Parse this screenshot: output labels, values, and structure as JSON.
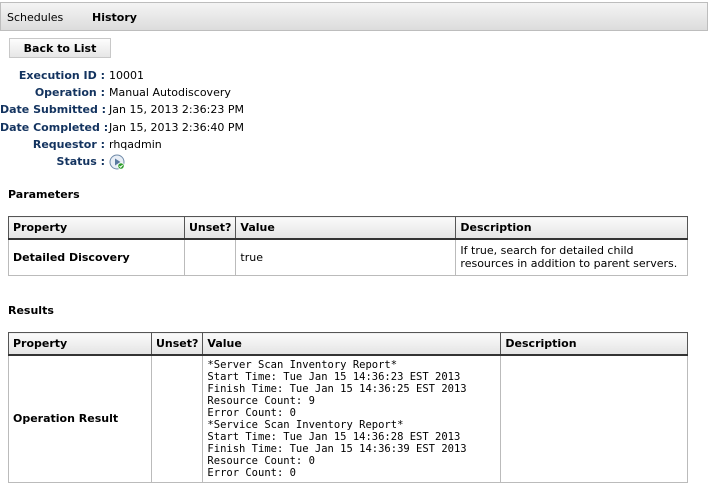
{
  "tabs": [
    "Schedules",
    "History"
  ],
  "back_label": "Back to List",
  "details": [
    {
      "label": "Execution ID :",
      "value": "10001"
    },
    {
      "label": "Operation :",
      "value": "Manual Autodiscovery"
    },
    {
      "label": "Date Submitted :",
      "value": "Jan 15, 2013 2:36:23 PM"
    },
    {
      "label": "Date Completed :",
      "value": "Jan 15, 2013 2:36:40 PM"
    },
    {
      "label": "Requestor :",
      "value": "rhqadmin"
    },
    {
      "label": "Status :",
      "value": ""
    }
  ],
  "status_color": "#2d9c2d",
  "status_icon": "play-success-icon",
  "parameters": {
    "title": "Parameters",
    "headers": [
      "Property",
      "Unset?",
      "Value",
      "Description"
    ],
    "rows": [
      {
        "property": "Detailed Discovery",
        "unset": "",
        "value": "true",
        "description": "If true, search for detailed child resources in addition to parent servers."
      }
    ]
  },
  "results": {
    "title": "Results",
    "headers": [
      "Property",
      "Unset?",
      "Value",
      "Description"
    ],
    "rows": [
      {
        "property": "Operation Result",
        "unset": "",
        "value": "*Server Scan Inventory Report*\nStart Time: Tue Jan 15 14:36:23 EST 2013\nFinish Time: Tue Jan 15 14:36:25 EST 2013\nResource Count: 9\nError Count: 0\n*Service Scan Inventory Report*\nStart Time: Tue Jan 15 14:36:28 EST 2013\nFinish Time: Tue Jan 15 14:36:39 EST 2013\nResource Count: 0\nError Count: 0",
        "description": ""
      }
    ]
  }
}
